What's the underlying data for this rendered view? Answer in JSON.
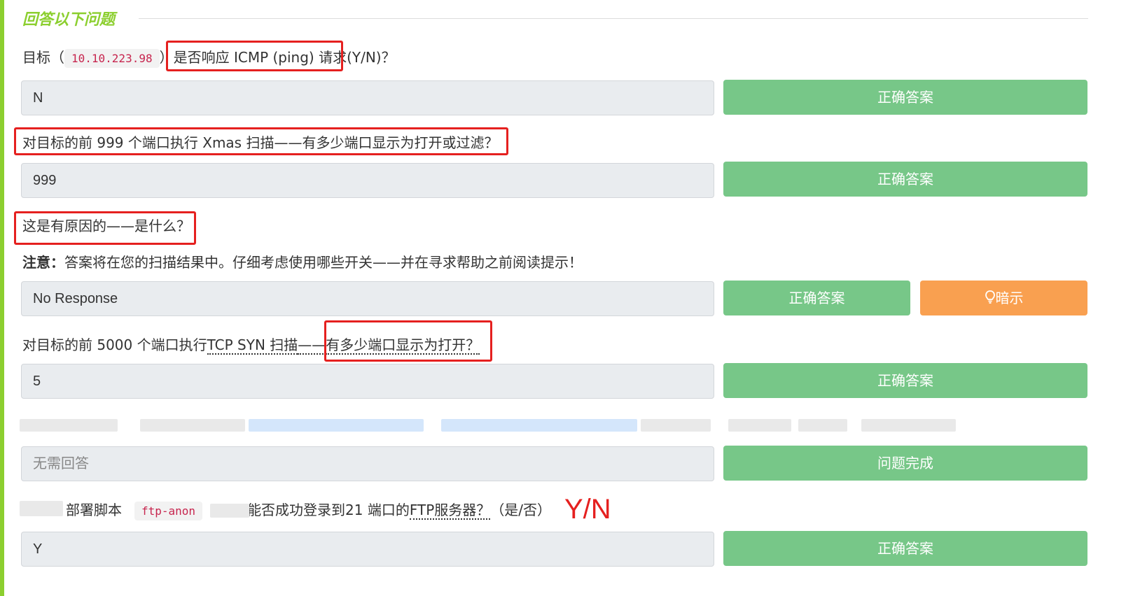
{
  "section_title": "回答以下问题",
  "questions": [
    {
      "parts": [
        "目标（",
        "10.10.223.98",
        "）",
        "是否响应 ICMP (ping) 请求",
        "(Y/N)？"
      ],
      "answer": "N",
      "button": "正确答案"
    },
    {
      "text": "对目标的前 999 个端口执行 Xmas 扫描——有多少端口显示为打开或过滤？",
      "answer": "999",
      "button": "正确答案"
    },
    {
      "text": "这是有原因的——是什么？",
      "note_label": "注意：",
      "note_text": "答案将在您的扫描结果中。仔细考虑使用哪些开关——并在寻求帮助之前阅读提示！",
      "answer": "No Response",
      "button": "正确答案",
      "hint_button": "暗示"
    },
    {
      "parts": [
        "对目标的前 5000 个端口执行",
        "TCP SYN 扫描",
        "——",
        "有多少端口显示为打开？"
      ],
      "answer": "5",
      "button": "正确答案"
    },
    {
      "answer_placeholder": "无需回答",
      "button": "问题完成"
    },
    {
      "parts": [
        "部署脚本",
        "ftp-anon",
        "能否成功登录到21 端口的",
        "FTP服务器？",
        "（是/否）"
      ],
      "annotation": "Y/N",
      "answer": "Y",
      "button": "正确答案"
    }
  ],
  "colors": {
    "accent_green": "#8ccf2f",
    "button_green": "#77c788",
    "button_orange": "#f9a050",
    "highlight_red": "#e5201f"
  },
  "icons": {
    "hint": "lightbulb-icon"
  }
}
